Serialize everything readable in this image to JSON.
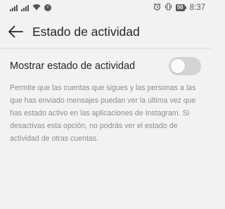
{
  "status_bar": {
    "icons": [
      "signal-bars-icon",
      "signal-bars-icon",
      "wifi-icon",
      "messenger-icon"
    ],
    "right_icons": [
      "alarm-icon",
      "vibrate-icon"
    ],
    "battery": "98",
    "time": "8:37"
  },
  "toolbar": {
    "back_icon": "arrow-left-icon",
    "title": "Estado de actividad"
  },
  "setting": {
    "label": "Mostrar estado de actividad",
    "toggle_on": false
  },
  "description": "Permite que las cuentas que sigues y las personas a las que has enviado mensajes puedan ver la última vez que has estado activo en las aplicaciones de Instagram. Si desactivas esta opción, no podrás ver el estado de actividad de otras cuentas.",
  "colors": {
    "background": "#f2f2f2",
    "text": "#262626",
    "secondary_text": "#8e8e8e",
    "toggle_off": "#d4d4d4"
  }
}
